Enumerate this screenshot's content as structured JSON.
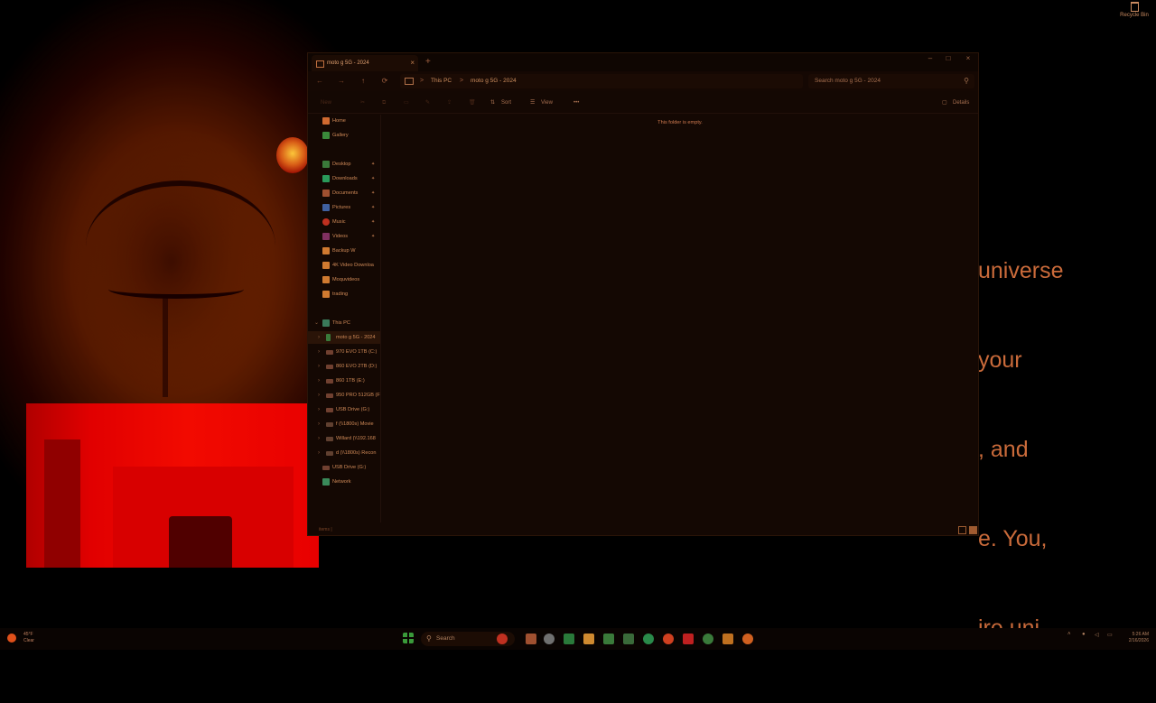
{
  "desktop": {
    "quote_lines": [
      "universe",
      "your",
      ", and",
      "e. You,",
      "ire uni-"
    ],
    "recycle_bin_label": "Recycle Bin"
  },
  "explorer": {
    "tab_title": "moto g 5G - 2024",
    "tab_close": "×",
    "new_tab": "+",
    "window_controls": {
      "minimize": "–",
      "maximize": "□",
      "close": "×"
    },
    "nav_buttons": {
      "back": "←",
      "forward": "→",
      "up": "↑",
      "refresh": "⟳"
    },
    "breadcrumb": [
      "This PC",
      "moto g 5G - 2024"
    ],
    "breadcrumb_sep": ">",
    "search_placeholder": "Search moto g 5G - 2024",
    "toolbar": {
      "new": "New",
      "sort": "Sort",
      "view": "View",
      "more": "•••",
      "details": "Details"
    },
    "nav_pane": {
      "quick": [
        {
          "label": "Home",
          "color": "#d06a30"
        },
        {
          "label": "Gallery",
          "color": "#3a8a3a"
        }
      ],
      "pinned": [
        {
          "label": "Desktop",
          "color": "#3a7a3a",
          "pin": "📌"
        },
        {
          "label": "Downloads",
          "color": "#2a9a5a",
          "pin": "📌"
        },
        {
          "label": "Documents",
          "color": "#a05030",
          "pin": "📌"
        },
        {
          "label": "Pictures",
          "color": "#4060a0",
          "pin": "📌"
        },
        {
          "label": "Music",
          "color": "#c03020",
          "pin": "📌"
        },
        {
          "label": "Videos",
          "color": "#803060",
          "pin": "📌"
        }
      ],
      "folders": [
        {
          "label": "Backup W"
        },
        {
          "label": "4K Video Downloa"
        },
        {
          "label": "Moquvideos"
        },
        {
          "label": "trading"
        }
      ],
      "this_pc_label": "This PC",
      "drives": [
        {
          "label": "moto g 5G - 2024",
          "selected": true
        },
        {
          "label": "970 EVO 1TB (C:)"
        },
        {
          "label": "860 EVO 2TB (D:)"
        },
        {
          "label": "860 1TB (E:)"
        },
        {
          "label": "950 PRO 512GB (F"
        },
        {
          "label": "USB Drive (G:)"
        },
        {
          "label": "f (\\\\1800s) Movie"
        },
        {
          "label": "Willard (\\\\192.168"
        },
        {
          "label": "d (\\\\1800s) Recon"
        }
      ],
      "usb_label": "USB Drive (G:)",
      "network_label": "Network"
    },
    "empty_message": "This folder is empty.",
    "status_text": "items  |"
  },
  "taskbar": {
    "weather_temp": "45°F",
    "weather_cond": "Clear",
    "search_label": "Search",
    "clock_time": "5:26 AM",
    "clock_date": "2/16/2026"
  },
  "colors": {
    "accent": "#d07a50",
    "window_bg": "#140803"
  }
}
